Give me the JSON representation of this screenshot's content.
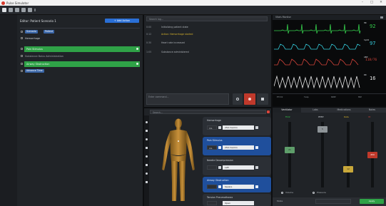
{
  "app": {
    "title": "Pulse Simulator"
  },
  "window_controls": {
    "minimize": "–",
    "maximize": "□",
    "close": "✕"
  },
  "scenario": {
    "header": "Editor: Patient Scenario 1",
    "action_button": "+ Add Action",
    "chips": [
      "Scenario",
      "Patient"
    ],
    "items": [
      {
        "label": "Hemorrhage",
        "highlight": false
      },
      {
        "label": "Pain Stimulus",
        "highlight": true
      },
      {
        "label": "Substance Bolus Administration",
        "highlight": false
      },
      {
        "label": "Airway Obstruction",
        "highlight": true
      }
    ],
    "sub_chip": "Advance Time"
  },
  "log": {
    "search_placeholder": "Search log...",
    "entries": [
      {
        "time": "0:00",
        "text": "Initializing patient state"
      },
      {
        "time": "0:12",
        "text": "Action: Hemorrhage started",
        "warn": true
      },
      {
        "time": "0:30",
        "text": "Heart rate increased"
      },
      {
        "time": "1:05",
        "text": "Substance administered"
      }
    ],
    "input_placeholder": "Enter command..."
  },
  "monitor": {
    "title": "Vitals Monitor",
    "vitals": [
      {
        "label": "HR",
        "value": "92",
        "color": "#35d04c"
      },
      {
        "label": "SpO2",
        "value": "97",
        "color": "#35d0e0"
      },
      {
        "label": "ABP",
        "value": "118/76",
        "color": "#d8453b"
      },
      {
        "label": "RR",
        "value": "16",
        "color": "#e6e6e6"
      }
    ],
    "footer_labels": [
      "ETCO2",
      "Temp",
      "NIBP",
      "MAP"
    ]
  },
  "body_panel": {
    "search_placeholder": "Search...",
    "cards": [
      {
        "title": "Hemorrhage",
        "unit": "mL",
        "value": "250 mL/min",
        "active": false
      },
      {
        "title": "Pain Stimulus",
        "unit": "mL",
        "value": "250 mL/min",
        "active": true
      },
      {
        "title": "Needle Decompression",
        "unit": "",
        "value": "Left",
        "active": false
      },
      {
        "title": "Airway Obstruction",
        "unit": "",
        "value": "Severe",
        "active": true
      },
      {
        "title": "Tension Pneumothorax",
        "unit": "",
        "value": "Open",
        "active": false
      }
    ]
  },
  "controls": {
    "tabs": [
      "Ventilator",
      "Labs",
      "Medications",
      "Notes"
    ],
    "channels": [
      {
        "label": "FiO2",
        "value": "21",
        "color": "#35d04c"
      },
      {
        "label": "PEEP",
        "value": "5",
        "color": "#cfd3d8"
      },
      {
        "label": "Rate",
        "value": "12",
        "color": "#d6b22a"
      },
      {
        "label": "Vt",
        "value": "450",
        "color": "#d8453b"
      }
    ],
    "options": [
      "Volume",
      "Pressure"
    ],
    "footer": [
      "Mode",
      "Apply"
    ]
  },
  "colors": {
    "accent": "#2a6fd6",
    "green": "#2fa247",
    "red": "#d8453b"
  }
}
